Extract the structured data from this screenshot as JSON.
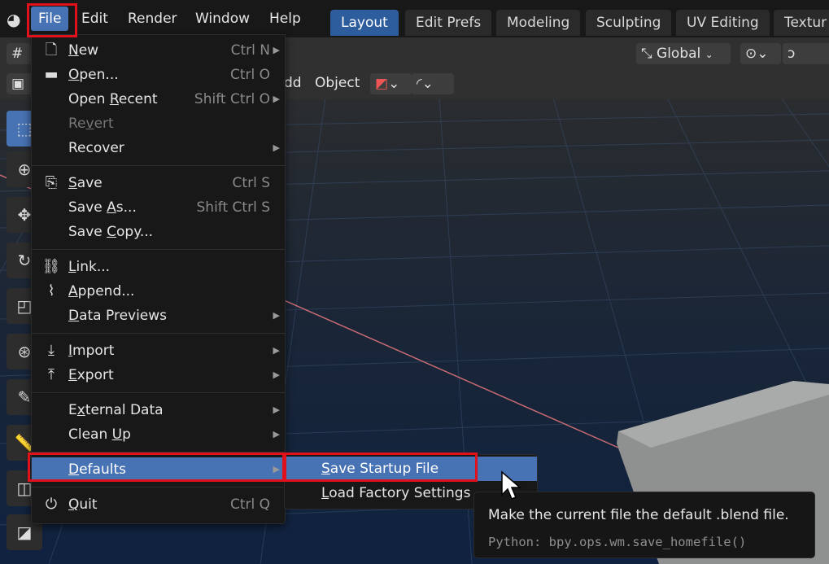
{
  "menubar": {
    "items": [
      "File",
      "Edit",
      "Render",
      "Window",
      "Help"
    ],
    "active": "File"
  },
  "workspace_tabs": [
    "Layout",
    "Edit Prefs",
    "Modeling",
    "Sculpting",
    "UV Editing",
    "Textur"
  ],
  "header": {
    "transform_orientation": "Global",
    "mode_menu_partial": "dd",
    "object_menu": "Object"
  },
  "file_menu": {
    "items": [
      {
        "icon": "new-file-icon",
        "label": "New",
        "underline": "N",
        "shortcut": "Ctrl N",
        "submenu": true
      },
      {
        "icon": "folder-icon",
        "label": "Open...",
        "underline": "O",
        "shortcut": "Ctrl O",
        "submenu": false
      },
      {
        "icon": "",
        "label": "Open Recent",
        "underline": "R",
        "shortcut": "Shift Ctrl O",
        "submenu": true
      },
      {
        "icon": "",
        "label": "Revert",
        "underline": "v",
        "shortcut": "",
        "submenu": false,
        "disabled": true
      },
      {
        "icon": "",
        "label": "Recover",
        "underline": "",
        "shortcut": "",
        "submenu": true
      },
      {
        "icon": "save-icon",
        "label": "Save",
        "underline": "S",
        "shortcut": "Ctrl S",
        "submenu": false
      },
      {
        "icon": "",
        "label": "Save As...",
        "underline": "A",
        "shortcut": "Shift Ctrl S",
        "submenu": false
      },
      {
        "icon": "",
        "label": "Save Copy...",
        "underline": "C",
        "shortcut": "",
        "submenu": false
      },
      {
        "icon": "link-icon",
        "label": "Link...",
        "underline": "L",
        "shortcut": "",
        "submenu": false
      },
      {
        "icon": "paperclip-icon",
        "label": "Append...",
        "underline": "A",
        "shortcut": "",
        "submenu": false
      },
      {
        "icon": "",
        "label": "Data Previews",
        "underline": "D",
        "shortcut": "",
        "submenu": true
      },
      {
        "icon": "import-icon",
        "label": "Import",
        "underline": "I",
        "shortcut": "",
        "submenu": true
      },
      {
        "icon": "export-icon",
        "label": "Export",
        "underline": "E",
        "shortcut": "",
        "submenu": true
      },
      {
        "icon": "",
        "label": "External Data",
        "underline": "x",
        "shortcut": "",
        "submenu": true
      },
      {
        "icon": "",
        "label": "Clean Up",
        "underline": "U",
        "shortcut": "",
        "submenu": true
      },
      {
        "icon": "",
        "label": "Defaults",
        "underline": "D",
        "shortcut": "",
        "submenu": true,
        "highlighted": true
      },
      {
        "icon": "power-icon",
        "label": "Quit",
        "underline": "Q",
        "shortcut": "Ctrl Q",
        "submenu": false
      }
    ]
  },
  "defaults_submenu": {
    "items": [
      {
        "label": "Save Startup File",
        "underline": "S",
        "highlighted": true
      },
      {
        "label": "Load Factory Settings",
        "underline": "L",
        "highlighted": false
      }
    ]
  },
  "tooltip": {
    "description": "Make the current file the default .blend file.",
    "python": "Python: bpy.ops.wm.save_homefile()"
  },
  "colors": {
    "accent": "#4772b3",
    "highlight_box": "#e0111b",
    "menu_bg": "#181818"
  }
}
